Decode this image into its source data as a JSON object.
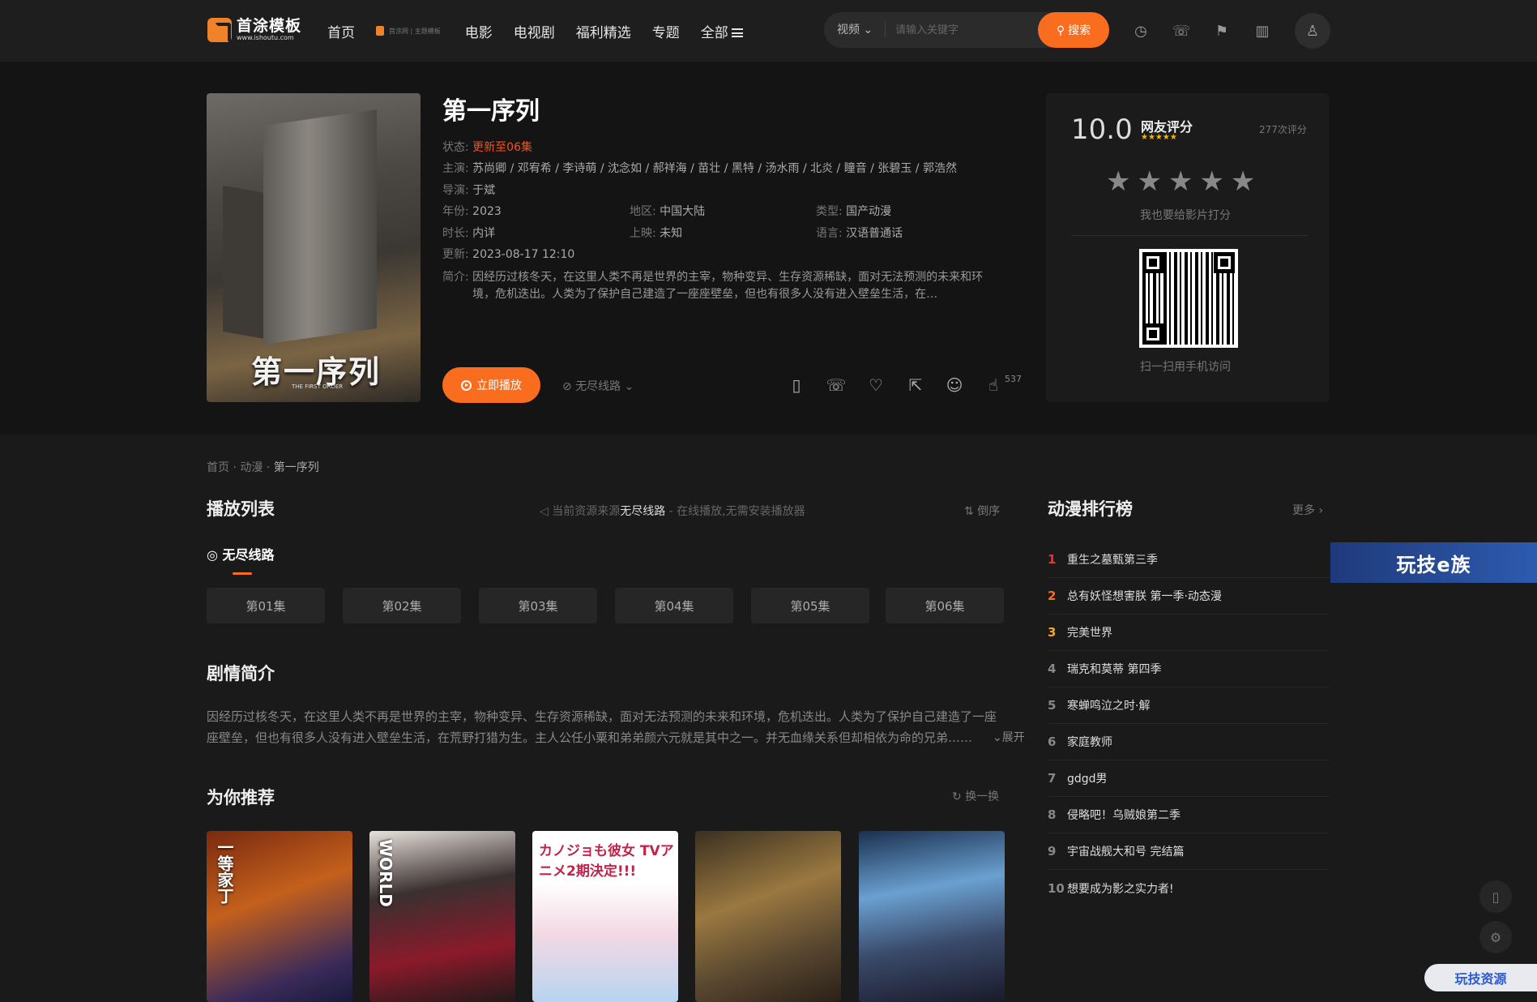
{
  "header": {
    "logo_name": "首涂模板",
    "logo_url": "www.ishoutu.com",
    "nav": [
      "首页",
      "电影",
      "电视剧",
      "福利精选",
      "专题",
      "全部"
    ],
    "nav_badge_text": "首涂网 | 主题模板",
    "search": {
      "type": "视频",
      "placeholder": "请输入关键字",
      "button": "搜索"
    }
  },
  "detail": {
    "title": "第一序列",
    "poster_title": "第一序列",
    "poster_subtitle": "THE FIRST ORDER",
    "status_key": "状态:",
    "status": "更新至06集",
    "cast_key": "主演:",
    "cast": "苏尚卿 / 邓宥希 / 李诗萌 / 沈念如 / 郝祥海 / 苗壮 / 黑特 / 汤水雨 / 北炎 / 瞳音 / 张碧玉 / 郭浩然",
    "director_key": "导演:",
    "director": "于斌",
    "year_key": "年份:",
    "year": "2023",
    "region_key": "地区:",
    "region": "中国大陆",
    "genre_key": "类型:",
    "genre": "国产动漫",
    "duration_key": "时长:",
    "duration": "内详",
    "release_key": "上映:",
    "release": "未知",
    "language_key": "语言:",
    "language": "汉语普通话",
    "updated_key": "更新:",
    "updated": "2023-08-17 12:10",
    "intro_key": "简介:",
    "intro": "因经历过核冬天，在这里人类不再是世界的主宰，物种变异、生存资源稀缺，面对无法预测的未来和环境，危机迭出。人类为了保护自己建造了一座座壁垒，但也有很多人没有进入壁垒生活，在…",
    "play_button": "立即播放",
    "line_select": "无尽线路",
    "like_count": "537"
  },
  "rating": {
    "score": "10.0",
    "label": "网友评分",
    "count": "277次评分",
    "stars": "★★★★★",
    "hint": "我也要给影片打分",
    "qr_hint": "扫一扫用手机访问"
  },
  "breadcrumb": [
    "首页",
    "动漫",
    "第一序列"
  ],
  "playlist": {
    "title": "播放列表",
    "source_prefix": "当前资源来源",
    "source_name": "无尽线路",
    "source_suffix": " - 在线播放,无需安装播放器",
    "reverse": "倒序",
    "line_tab": "无尽线路",
    "episodes": [
      "第01集",
      "第02集",
      "第03集",
      "第04集",
      "第05集",
      "第06集"
    ]
  },
  "synopsis": {
    "title": "剧情简介",
    "text": "因经历过核冬天，在这里人类不再是世界的主宰，物种变异、生存资源稀缺，面对无法预测的未来和环境，危机迭出。人类为了保护自己建造了一座座壁垒，但也有很多人没有进入壁垒生活，在荒野打猎为生。主人公任小粟和弟弟颜六元就是其中之一。并无血缘关系但却相依为命的兄弟……",
    "expand": "展开"
  },
  "recommend": {
    "title": "为你推荐",
    "refresh": "换一换",
    "items": [
      "一等家丁",
      "WORLD",
      "カノジョも彼女 TVアニメ2期決定!!!",
      "",
      ""
    ]
  },
  "ranking": {
    "title": "动漫排行榜",
    "more": "更多",
    "items": [
      {
        "n": "1",
        "name": "重生之墓甄第三季"
      },
      {
        "n": "2",
        "name": "总有妖怪想害朕 第一季·动态漫"
      },
      {
        "n": "3",
        "name": "完美世界"
      },
      {
        "n": "4",
        "name": "瑞克和莫蒂 第四季"
      },
      {
        "n": "5",
        "name": "寒蝉鸣泣之时·解"
      },
      {
        "n": "6",
        "name": "家庭教师"
      },
      {
        "n": "7",
        "name": "gdgd男"
      },
      {
        "n": "8",
        "name": "侵略吧！乌贼娘第二季"
      },
      {
        "n": "9",
        "name": "宇宙战舰大和号 完结篇"
      },
      {
        "n": "10",
        "name": "想要成为影之实力者!"
      }
    ]
  },
  "ads": {
    "banner": "玩技e族",
    "pill": "玩技资源"
  },
  "colors": {
    "accent": "#fa6d1e",
    "status_red": "#f5501e",
    "star_gold": "#f5b800",
    "bg": "#1a1a1a"
  }
}
